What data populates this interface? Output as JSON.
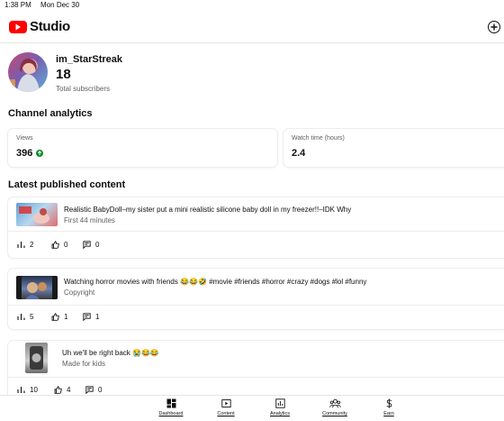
{
  "status_bar": {
    "time": "1:38 PM",
    "date": "Mon Dec 30"
  },
  "header": {
    "app_title": "Studio",
    "create_icon": "plus-circle-icon"
  },
  "channel": {
    "name": "im_StarStreak",
    "subscribers": "18",
    "subscribers_label": "Total subscribers"
  },
  "analytics": {
    "title": "Channel analytics",
    "views": {
      "label": "Views",
      "value": "396",
      "trend": "up"
    },
    "watch_time": {
      "label": "Watch time (hours)",
      "value": "2.4"
    }
  },
  "latest": {
    "title": "Latest published content",
    "items": [
      {
        "title": "Realistic BabyDoll–my sister put a mini realistic silicone baby doll in my freezer!!–IDK Why",
        "subtitle": "First 44 minutes",
        "views": "2",
        "likes": "0",
        "comments": "0"
      },
      {
        "title": "Watching horror movies with friends 😂😂🤣 #movie #friends #horror #crazy #dogs #lol #funny",
        "subtitle": "Copyright",
        "views": "5",
        "likes": "1",
        "comments": "1"
      },
      {
        "title": "Uh we'll be right back 😭😂😂",
        "subtitle": "Made for kids",
        "views": "10",
        "likes": "4",
        "comments": "0"
      }
    ]
  },
  "bottom_nav": {
    "items": [
      {
        "label": "Dashboard",
        "icon": "dashboard-icon"
      },
      {
        "label": "Content",
        "icon": "content-icon"
      },
      {
        "label": "Analytics",
        "icon": "analytics-icon"
      },
      {
        "label": "Community",
        "icon": "community-icon"
      },
      {
        "label": "Earn",
        "icon": "earn-icon"
      }
    ]
  },
  "colors": {
    "brand_red": "#ff0000",
    "trend_green": "#0a8c2c",
    "text_primary": "#0f0f0f",
    "text_secondary": "#606060"
  }
}
